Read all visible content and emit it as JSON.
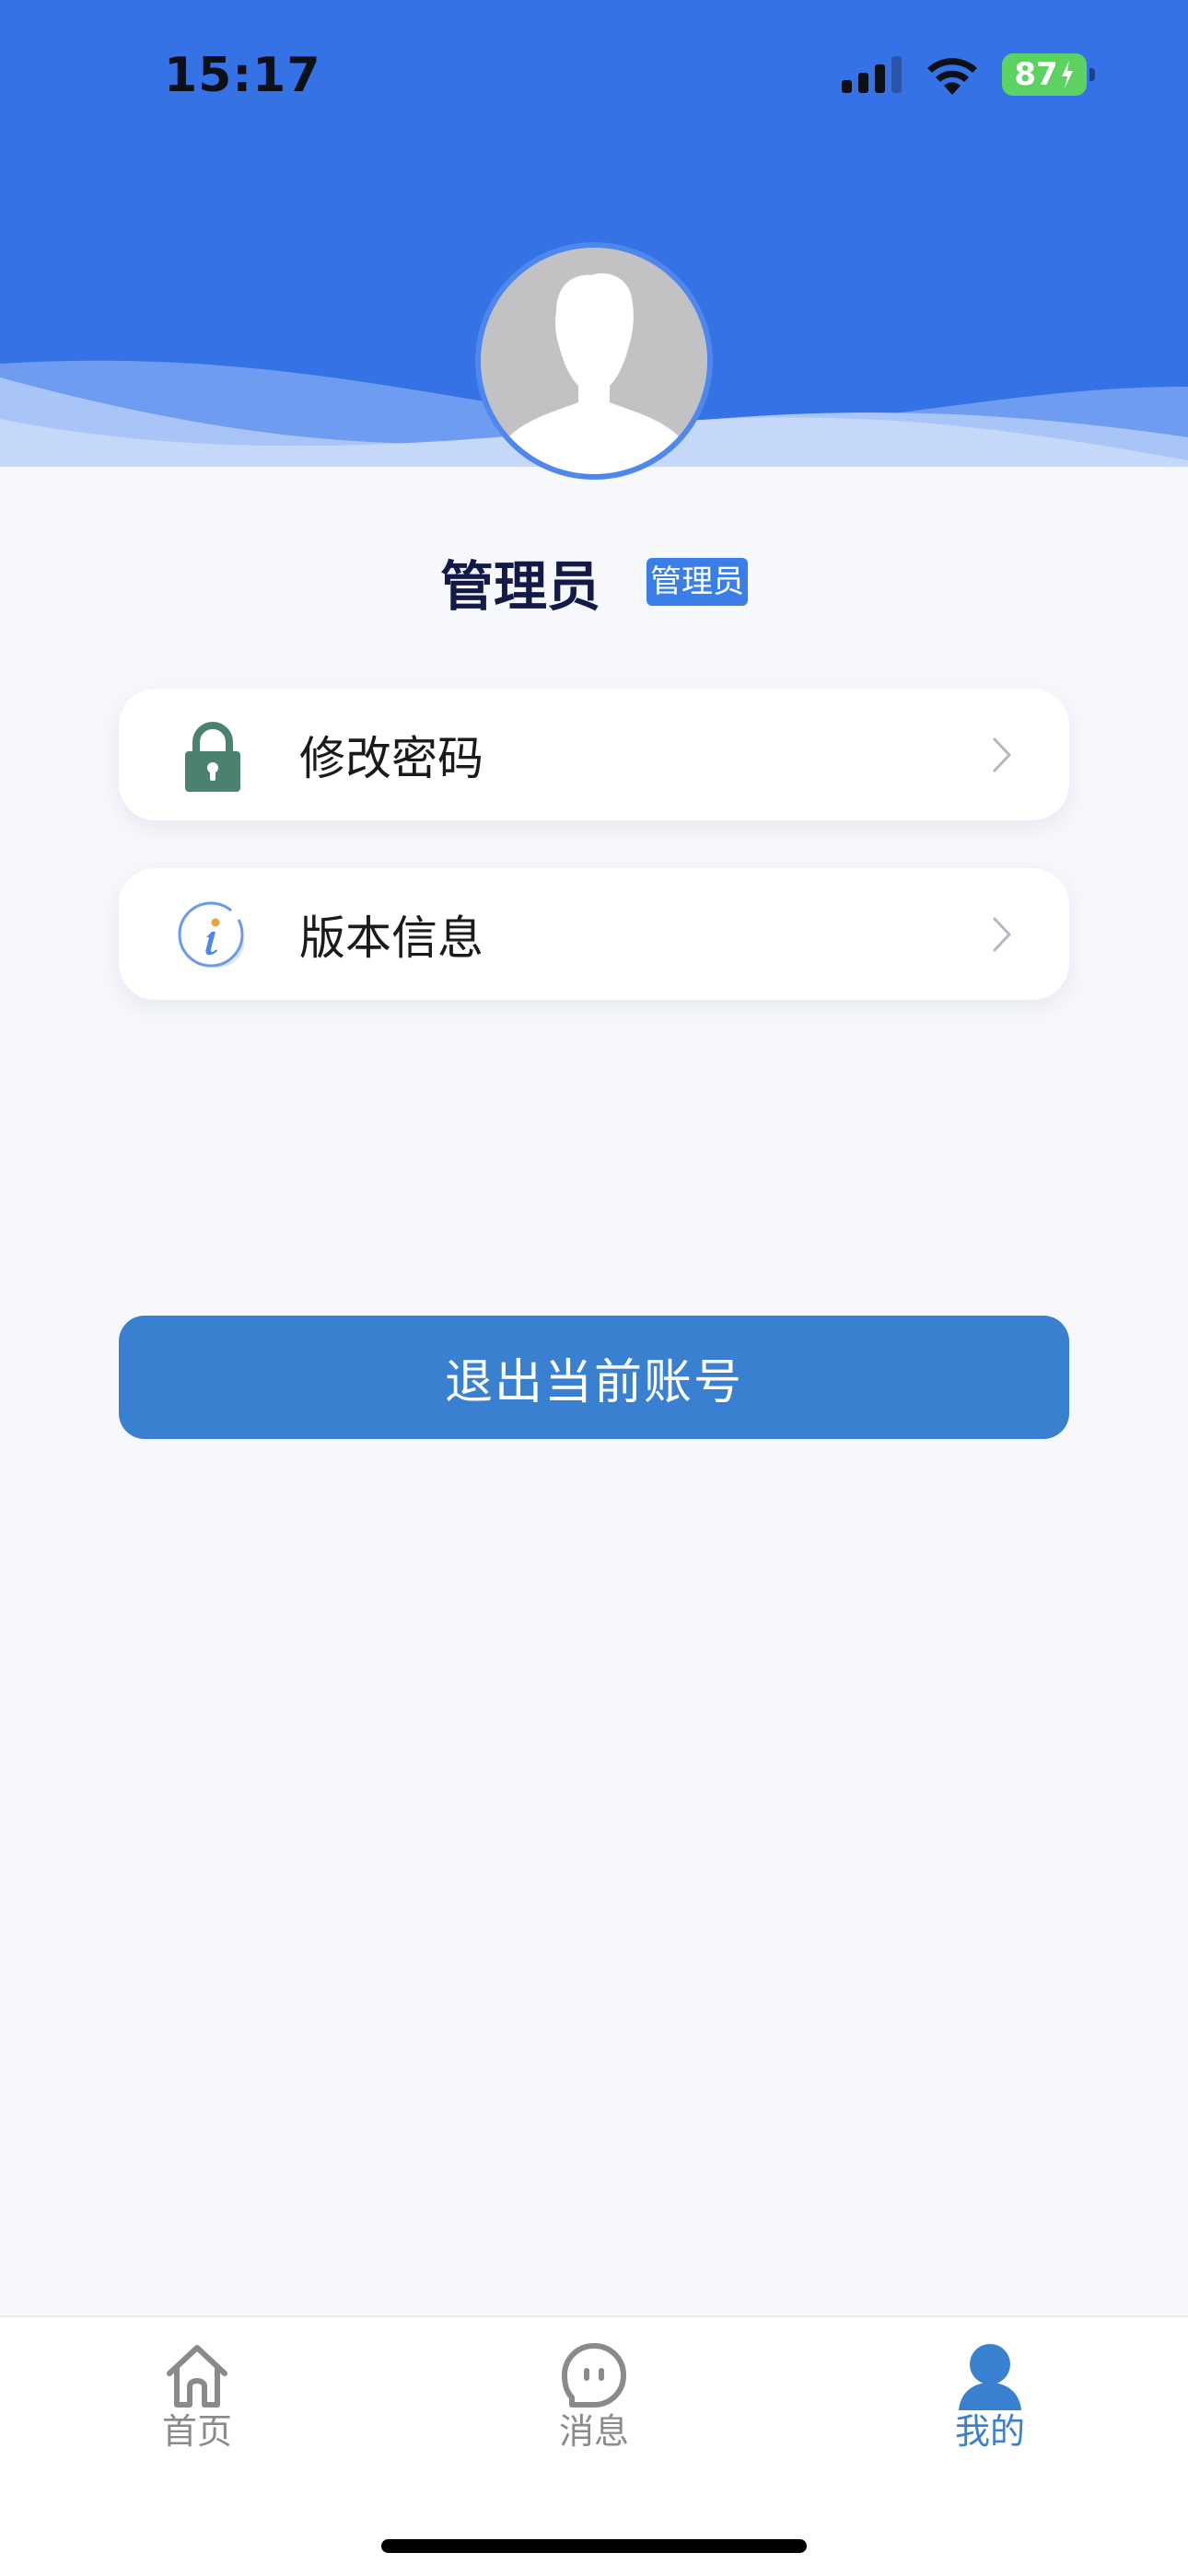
{
  "status_bar": {
    "time": "15:17",
    "battery": "87"
  },
  "profile": {
    "name": "管理员",
    "role": "管理员"
  },
  "menu": [
    {
      "label": "修改密码",
      "icon": "lock-icon"
    },
    {
      "label": "版本信息",
      "icon": "info-icon"
    }
  ],
  "logout_label": "退出当前账号",
  "tabs": [
    {
      "label": "首页",
      "icon": "home-icon",
      "active": false
    },
    {
      "label": "消息",
      "icon": "message-icon",
      "active": false
    },
    {
      "label": "我的",
      "icon": "user-icon",
      "active": true
    }
  ],
  "colors": {
    "header": "#3472e6",
    "accent": "#3a80d0",
    "active_tab": "#3a80d0",
    "inactive_tab": "#8a8a8a",
    "lock_icon": "#4a8170"
  }
}
